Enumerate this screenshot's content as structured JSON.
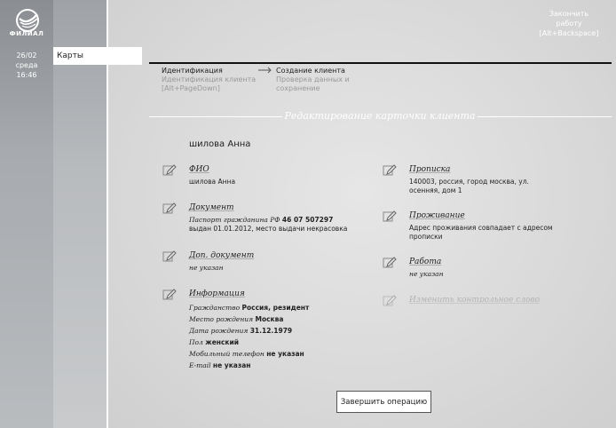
{
  "sidebar": {
    "logo_text": "ФИЛИАЛ",
    "date": "26/02",
    "weekday": "среда",
    "time": "16:46",
    "nav_items": [
      {
        "label": "Карты"
      }
    ]
  },
  "header": {
    "exit_line1": "Закончить",
    "exit_line2": "работу",
    "exit_line3": "[Alt+Backspace]"
  },
  "steps": [
    {
      "title": "Идентификация",
      "sub1": "Идентификация клиента",
      "sub2": "[Alt+PageDown]"
    },
    {
      "title": "Создание клиента",
      "sub1": "Проверка данных и",
      "sub2": "сохранение"
    }
  ],
  "section_title": "Редактирование карточки клиента",
  "client_name": "шилова Анна",
  "fields": {
    "fio": {
      "label": "ФИО",
      "value": "шилова Анна"
    },
    "document": {
      "label": "Документ",
      "line1_prefix": "Паспорт гражданина РФ",
      "line1_number": "46 07 507297",
      "line2": "выдан 01.01.2012, место выдачи некрасовка"
    },
    "extra_document": {
      "label": "Доп. документ",
      "value": "не указан"
    },
    "info": {
      "label": "Информация",
      "rows": [
        {
          "k": "Гражданство",
          "v": "Россия, резидент"
        },
        {
          "k": "Место рождения",
          "v": "Москва"
        },
        {
          "k": "Дата рождения",
          "v": "31.12.1979"
        },
        {
          "k": "Пол",
          "v": "женский"
        },
        {
          "k": "Мобильный телефон",
          "v": "не указан"
        },
        {
          "k": "E-mail",
          "v": "не указан"
        }
      ]
    },
    "registration": {
      "label": "Прописка",
      "line1": "140003, россия, город москва, ул.",
      "line2": "осенняя, дом 1"
    },
    "residence": {
      "label": "Проживание",
      "line1": "Адрес проживания совпадает с адресом",
      "line2": "прописки"
    },
    "work": {
      "label": "Работа",
      "value": "не указан"
    },
    "control_word": {
      "label": "Изменить контрольное слово"
    }
  },
  "buttons": {
    "finish": "Завершить операцию"
  },
  "colors": {
    "accent_line": "#111111",
    "panel_white": "#ffffff",
    "disabled_text": "#b3b3b3"
  }
}
